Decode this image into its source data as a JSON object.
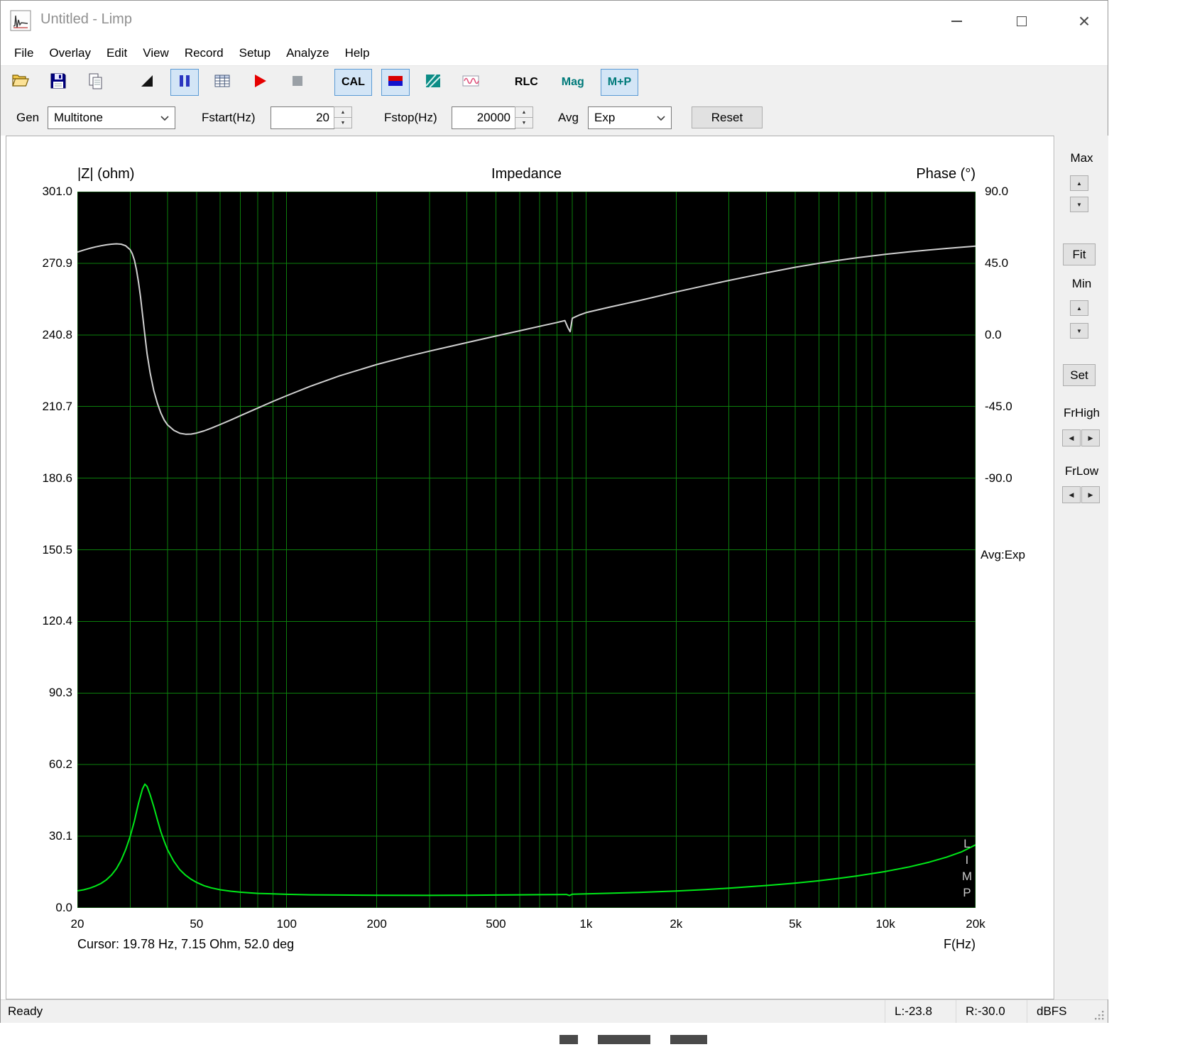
{
  "window": {
    "title": "Untitled - Limp"
  },
  "menu": {
    "items": [
      "File",
      "Overlay",
      "Edit",
      "View",
      "Record",
      "Setup",
      "Analyze",
      "Help"
    ]
  },
  "toolbar": {
    "items": [
      {
        "name": "open",
        "type": "icon"
      },
      {
        "name": "save",
        "type": "icon"
      },
      {
        "name": "copy",
        "type": "icon",
        "gap_after": true
      },
      {
        "name": "pen",
        "type": "icon"
      },
      {
        "name": "pause",
        "type": "icon",
        "checked": true
      },
      {
        "name": "table",
        "type": "icon"
      },
      {
        "name": "play",
        "type": "icon"
      },
      {
        "name": "stop",
        "type": "icon",
        "gap_after": true
      },
      {
        "name": "cal",
        "type": "text",
        "label": "CAL",
        "checked": true
      },
      {
        "name": "generator",
        "type": "icon",
        "checked": true
      },
      {
        "name": "spectrum",
        "type": "icon"
      },
      {
        "name": "waveform",
        "type": "icon",
        "gap_after": true
      },
      {
        "name": "rlc",
        "type": "text",
        "label": "RLC"
      },
      {
        "name": "mag",
        "type": "text",
        "label": "Mag",
        "teal": true
      },
      {
        "name": "mp",
        "type": "text",
        "label": "M+P",
        "teal": true,
        "checked": true
      }
    ]
  },
  "controls": {
    "gen_label": "Gen",
    "gen_value": "Multitone",
    "fstart_label": "Fstart(Hz)",
    "fstart_value": "20",
    "fstop_label": "Fstop(Hz)",
    "fstop_value": "20000",
    "avg_label": "Avg",
    "avg_value": "Exp",
    "reset_label": "Reset"
  },
  "side_panel": {
    "max_label": "Max",
    "fit_label": "Fit",
    "min_label": "Min",
    "set_label": "Set",
    "frhigh_label": "FrHigh",
    "frlow_label": "FrLow"
  },
  "chart": {
    "left_title": "|Z| (ohm)",
    "title": "Impedance",
    "right_title": "Phase (°)",
    "xlabel": "F(Hz)",
    "cursor_text": "Cursor: 19.78 Hz, 7.15 Ohm, 52.0 deg",
    "avg_text": "Avg:Exp",
    "overlay_letters": [
      "L",
      "I",
      "M",
      "P"
    ]
  },
  "status": {
    "ready": "Ready",
    "l": "L:-23.8",
    "r": "R:-30.0",
    "unit": "dBFS"
  },
  "chart_data": {
    "type": "line",
    "title": "Impedance",
    "x_axis": {
      "label": "F(Hz)",
      "scale": "log",
      "min": 20,
      "max": 20000,
      "ticks": [
        {
          "f": 20,
          "label": "20"
        },
        {
          "f": 50,
          "label": "50"
        },
        {
          "f": 100,
          "label": "100"
        },
        {
          "f": 200,
          "label": "200"
        },
        {
          "f": 500,
          "label": "500"
        },
        {
          "f": 1000,
          "label": "1k"
        },
        {
          "f": 2000,
          "label": "2k"
        },
        {
          "f": 5000,
          "label": "5k"
        },
        {
          "f": 10000,
          "label": "10k"
        },
        {
          "f": 20000,
          "label": "20k"
        }
      ]
    },
    "left_axis": {
      "label": "|Z| (ohm)",
      "min": 0,
      "max": 301,
      "tick_labels": [
        "301.0",
        "270.9",
        "240.8",
        "210.7",
        "180.6",
        "150.5",
        "120.4",
        "90.3",
        "60.2",
        "30.1",
        "0.0"
      ]
    },
    "right_axis": {
      "label": "Phase (°)",
      "top_value": 90,
      "value_per_division": 45,
      "tick_labels": [
        "90.0",
        "45.0",
        "0.0",
        "-45.0",
        "-90.0"
      ]
    },
    "grid": {
      "color": "#0c7f0c",
      "background": "#000000"
    },
    "cursor": {
      "freq_hz": 19.78,
      "impedance_ohm": 7.15,
      "phase_deg": 52.0
    },
    "series": [
      {
        "name": "impedance-magnitude",
        "axis": "left",
        "unit": "ohm",
        "color": "#00e818",
        "points": [
          [
            20,
            7.15
          ],
          [
            21,
            7.6
          ],
          [
            22,
            8.3
          ],
          [
            23,
            9.2
          ],
          [
            24,
            10.3
          ],
          [
            25,
            11.8
          ],
          [
            26,
            13.8
          ],
          [
            27,
            16.5
          ],
          [
            28,
            20.0
          ],
          [
            29,
            24.5
          ],
          [
            30,
            30.0
          ],
          [
            31,
            36.5
          ],
          [
            32,
            44.0
          ],
          [
            33,
            50.0
          ],
          [
            33.6,
            52.0
          ],
          [
            34.2,
            51.0
          ],
          [
            35,
            47.5
          ],
          [
            36,
            42.5
          ],
          [
            37,
            37.0
          ],
          [
            38,
            32.0
          ],
          [
            39,
            28.0
          ],
          [
            40,
            24.5
          ],
          [
            42,
            19.5
          ],
          [
            44,
            16.0
          ],
          [
            46,
            13.7
          ],
          [
            48,
            12.0
          ],
          [
            50,
            10.7
          ],
          [
            53,
            9.3
          ],
          [
            56,
            8.4
          ],
          [
            60,
            7.6
          ],
          [
            65,
            7.0
          ],
          [
            70,
            6.6
          ],
          [
            80,
            6.1
          ],
          [
            90,
            5.9
          ],
          [
            100,
            5.7
          ],
          [
            120,
            5.5
          ],
          [
            150,
            5.4
          ],
          [
            200,
            5.3
          ],
          [
            300,
            5.25
          ],
          [
            400,
            5.3
          ],
          [
            500,
            5.4
          ],
          [
            600,
            5.5
          ],
          [
            700,
            5.55
          ],
          [
            800,
            5.6
          ],
          [
            860,
            5.65
          ],
          [
            880,
            5.2
          ],
          [
            900,
            5.75
          ],
          [
            1000,
            5.9
          ],
          [
            1200,
            6.15
          ],
          [
            1500,
            6.5
          ],
          [
            2000,
            7.1
          ],
          [
            2500,
            7.7
          ],
          [
            3000,
            8.3
          ],
          [
            4000,
            9.4
          ],
          [
            5000,
            10.4
          ],
          [
            6000,
            11.4
          ],
          [
            7000,
            12.4
          ],
          [
            8000,
            13.4
          ],
          [
            9000,
            14.4
          ],
          [
            10000,
            15.3
          ],
          [
            12000,
            17.2
          ],
          [
            14000,
            19.2
          ],
          [
            16000,
            21.3
          ],
          [
            18000,
            23.6
          ],
          [
            20000,
            26.5
          ]
        ]
      },
      {
        "name": "impedance-phase",
        "axis": "right",
        "unit": "deg",
        "color": "#d0d0d0",
        "points": [
          [
            20,
            52.0
          ],
          [
            21,
            53.3
          ],
          [
            22,
            54.4
          ],
          [
            23,
            55.3
          ],
          [
            24,
            56.0
          ],
          [
            25,
            56.6
          ],
          [
            26,
            57.0
          ],
          [
            27,
            57.2
          ],
          [
            28,
            57.0
          ],
          [
            29,
            56.0
          ],
          [
            30,
            53.5
          ],
          [
            30.5,
            51.0
          ],
          [
            31,
            47.0
          ],
          [
            31.5,
            41.0
          ],
          [
            32,
            33.0
          ],
          [
            32.5,
            24.0
          ],
          [
            33,
            13.0
          ],
          [
            33.6,
            0.0
          ],
          [
            34.2,
            -12.0
          ],
          [
            35,
            -24.0
          ],
          [
            36,
            -35.0
          ],
          [
            37,
            -43.0
          ],
          [
            38,
            -49.0
          ],
          [
            39,
            -53.5
          ],
          [
            40,
            -56.5
          ],
          [
            42,
            -60.0
          ],
          [
            44,
            -61.8
          ],
          [
            46,
            -62.4
          ],
          [
            48,
            -62.3
          ],
          [
            50,
            -61.7
          ],
          [
            53,
            -60.3
          ],
          [
            56,
            -58.6
          ],
          [
            60,
            -56.3
          ],
          [
            65,
            -53.5
          ],
          [
            70,
            -50.8
          ],
          [
            80,
            -46.0
          ],
          [
            90,
            -41.8
          ],
          [
            100,
            -38.2
          ],
          [
            120,
            -32.3
          ],
          [
            150,
            -25.8
          ],
          [
            200,
            -18.6
          ],
          [
            250,
            -13.8
          ],
          [
            300,
            -10.2
          ],
          [
            400,
            -4.8
          ],
          [
            500,
            -0.7
          ],
          [
            600,
            2.6
          ],
          [
            700,
            5.4
          ],
          [
            800,
            7.8
          ],
          [
            850,
            9.0
          ],
          [
            870,
            4.5
          ],
          [
            885,
            2.0
          ],
          [
            900,
            10.5
          ],
          [
            950,
            12.5
          ],
          [
            1000,
            14.0
          ],
          [
            1200,
            17.5
          ],
          [
            1500,
            21.5
          ],
          [
            2000,
            27.0
          ],
          [
            2500,
            31.0
          ],
          [
            3000,
            34.2
          ],
          [
            3500,
            36.8
          ],
          [
            4000,
            39.0
          ],
          [
            5000,
            42.5
          ],
          [
            6000,
            45.0
          ],
          [
            7000,
            46.9
          ],
          [
            8000,
            48.4
          ],
          [
            9000,
            49.6
          ],
          [
            10000,
            50.6
          ],
          [
            12000,
            52.2
          ],
          [
            14000,
            53.4
          ],
          [
            16000,
            54.3
          ],
          [
            18000,
            55.1
          ],
          [
            20000,
            55.8
          ]
        ]
      }
    ]
  }
}
